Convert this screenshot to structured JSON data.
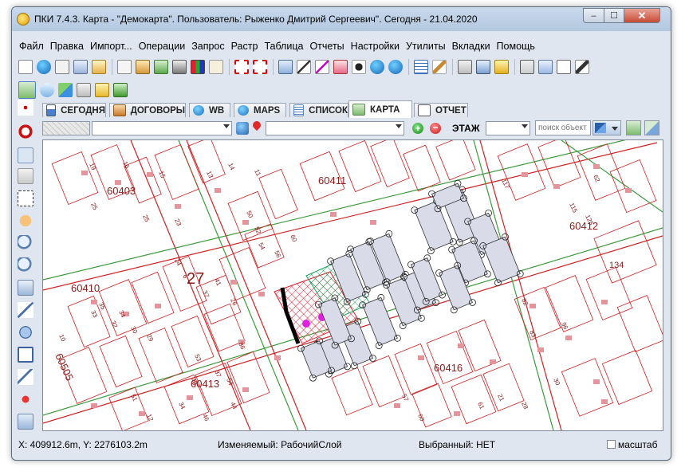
{
  "window": {
    "title": "ПКИ 7.4.3. Карта - \"Демокарта\". Пользователь: Рыженко Дмитрий Сергеевич\". Сегодня - 21.04.2020",
    "close_glyph": "✕",
    "max_glyph": "☐",
    "min_glyph": "–"
  },
  "menu": [
    "Файл",
    "Правка",
    "Импорт...",
    "Операции",
    "Запрос",
    "Растр",
    "Таблица",
    "Отчеты",
    "Настройки",
    "Утилиты",
    "Вкладки",
    "Помощь"
  ],
  "tabs": [
    {
      "label": "СЕГОДНЯ",
      "icon": "calendar-icon",
      "active": false
    },
    {
      "label": "ДОГОВОРЫ",
      "icon": "contract-icon",
      "active": false
    },
    {
      "label": "WB",
      "icon": "globe-icon",
      "active": false
    },
    {
      "label": "MAPS",
      "icon": "globe-icon",
      "active": false
    },
    {
      "label": "СПИСОК",
      "icon": "list-icon",
      "active": false
    },
    {
      "label": "КАРТА",
      "icon": "map-icon",
      "active": true
    },
    {
      "label": "ОТЧЕТ",
      "icon": "report-icon",
      "active": false
    }
  ],
  "map_toolbar": {
    "layer_select_value": "",
    "object_select_value": "",
    "floor_label": "ЭТАЖ",
    "floor_value": "",
    "search_placeholder": "поиск объект"
  },
  "map": {
    "block_labels": [
      "60403",
      "60411",
      "60412",
      "60410",
      "27",
      "60505",
      "60413",
      "60416",
      "134"
    ],
    "parcel_numbers": [
      "19",
      "16",
      "15",
      "25",
      "25",
      "23",
      "13",
      "14",
      "11",
      "50",
      "52",
      "54",
      "56",
      "60",
      "24",
      "6",
      "41",
      "37",
      "35",
      "33",
      "34",
      "32",
      "30",
      "29",
      "10",
      "26",
      "82",
      "83",
      "96",
      "117",
      "86",
      "53",
      "37",
      "48",
      "34",
      "46",
      "44",
      "54",
      "51",
      "12",
      "57",
      "60",
      "61",
      "21",
      "28",
      "30",
      "115",
      "125",
      "62"
    ],
    "colors": {
      "boundary_red": "#d02020",
      "road_green": "#3c9a3c",
      "building_fill": "#d9dbe9",
      "red_hatch": "#e02030",
      "green_hatch": "#20a060",
      "accent_magenta": "#e020e0"
    }
  },
  "status": {
    "coords": "X: 409912.6m, Y: 2276103.2m",
    "editable_layer": "Изменяемый: РабочийСлой",
    "selected": "Выбранный: НЕТ",
    "scale_label": "масштаб"
  }
}
